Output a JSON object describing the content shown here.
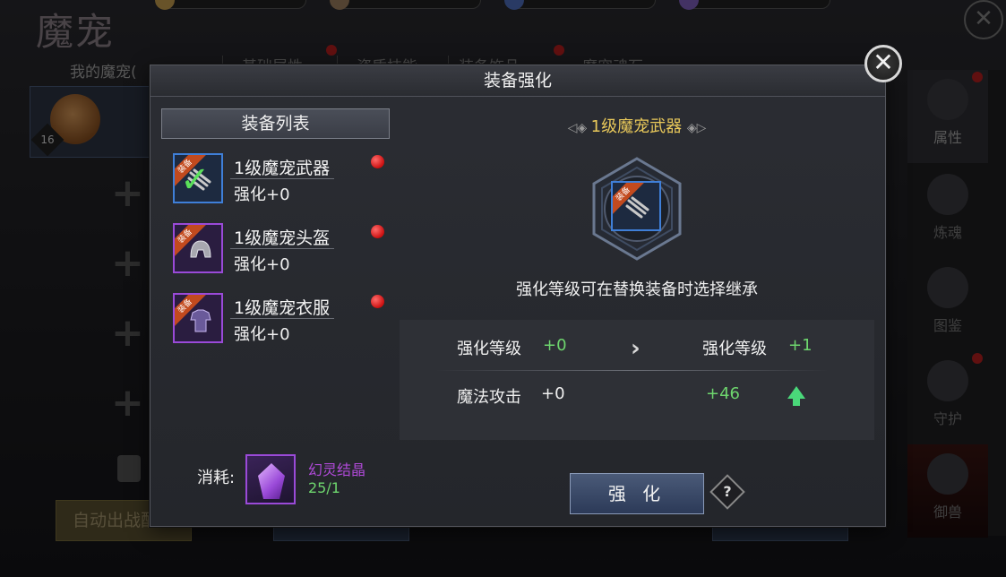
{
  "background": {
    "title": "魔宠",
    "my_pets_label": "我的魔宠(",
    "tabs": [
      "基础属性",
      "资质技能",
      "装备饰品",
      "魔宠魂石"
    ],
    "pet_level": "16",
    "auto_battle_label": "自动出战配置",
    "side_nav": [
      "属性",
      "炼魂",
      "图鉴",
      "守护",
      "御兽"
    ]
  },
  "dialog": {
    "title": "装备强化",
    "close_label": "✕"
  },
  "equipment_list": {
    "header": "装备列表",
    "items": [
      {
        "name": "1级魔宠武器",
        "level": "强化+0",
        "ribbon": "装备",
        "quality_color": "#3f7fd8",
        "selected": true
      },
      {
        "name": "1级魔宠头盔",
        "level": "强化+0",
        "ribbon": "装备",
        "quality_color": "#9a4ad8",
        "selected": false
      },
      {
        "name": "1级魔宠衣服",
        "level": "强化+0",
        "ribbon": "装备",
        "quality_color": "#9a4ad8",
        "selected": false
      }
    ]
  },
  "detail": {
    "title": "1级魔宠武器",
    "ribbon": "装备",
    "hint": "强化等级可在替换装备时选择继承",
    "current_level_label": "强化等级",
    "current_level_value": "+0",
    "next_level_label": "强化等级",
    "next_level_value": "+1",
    "stat_label": "魔法攻击",
    "stat_current": "+0",
    "stat_next": "+46"
  },
  "cost": {
    "label": "消耗:",
    "item_name": "幻灵结晶",
    "quantity": "25/1"
  },
  "actions": {
    "enhance_label": "强 化",
    "help_label": "?"
  },
  "colors": {
    "accent_gold": "#e8c85a",
    "increase_green": "#6ed66e",
    "alert_red": "#cc1010",
    "rare_blue": "#3f7fd8",
    "epic_purple": "#9a4ad8"
  }
}
